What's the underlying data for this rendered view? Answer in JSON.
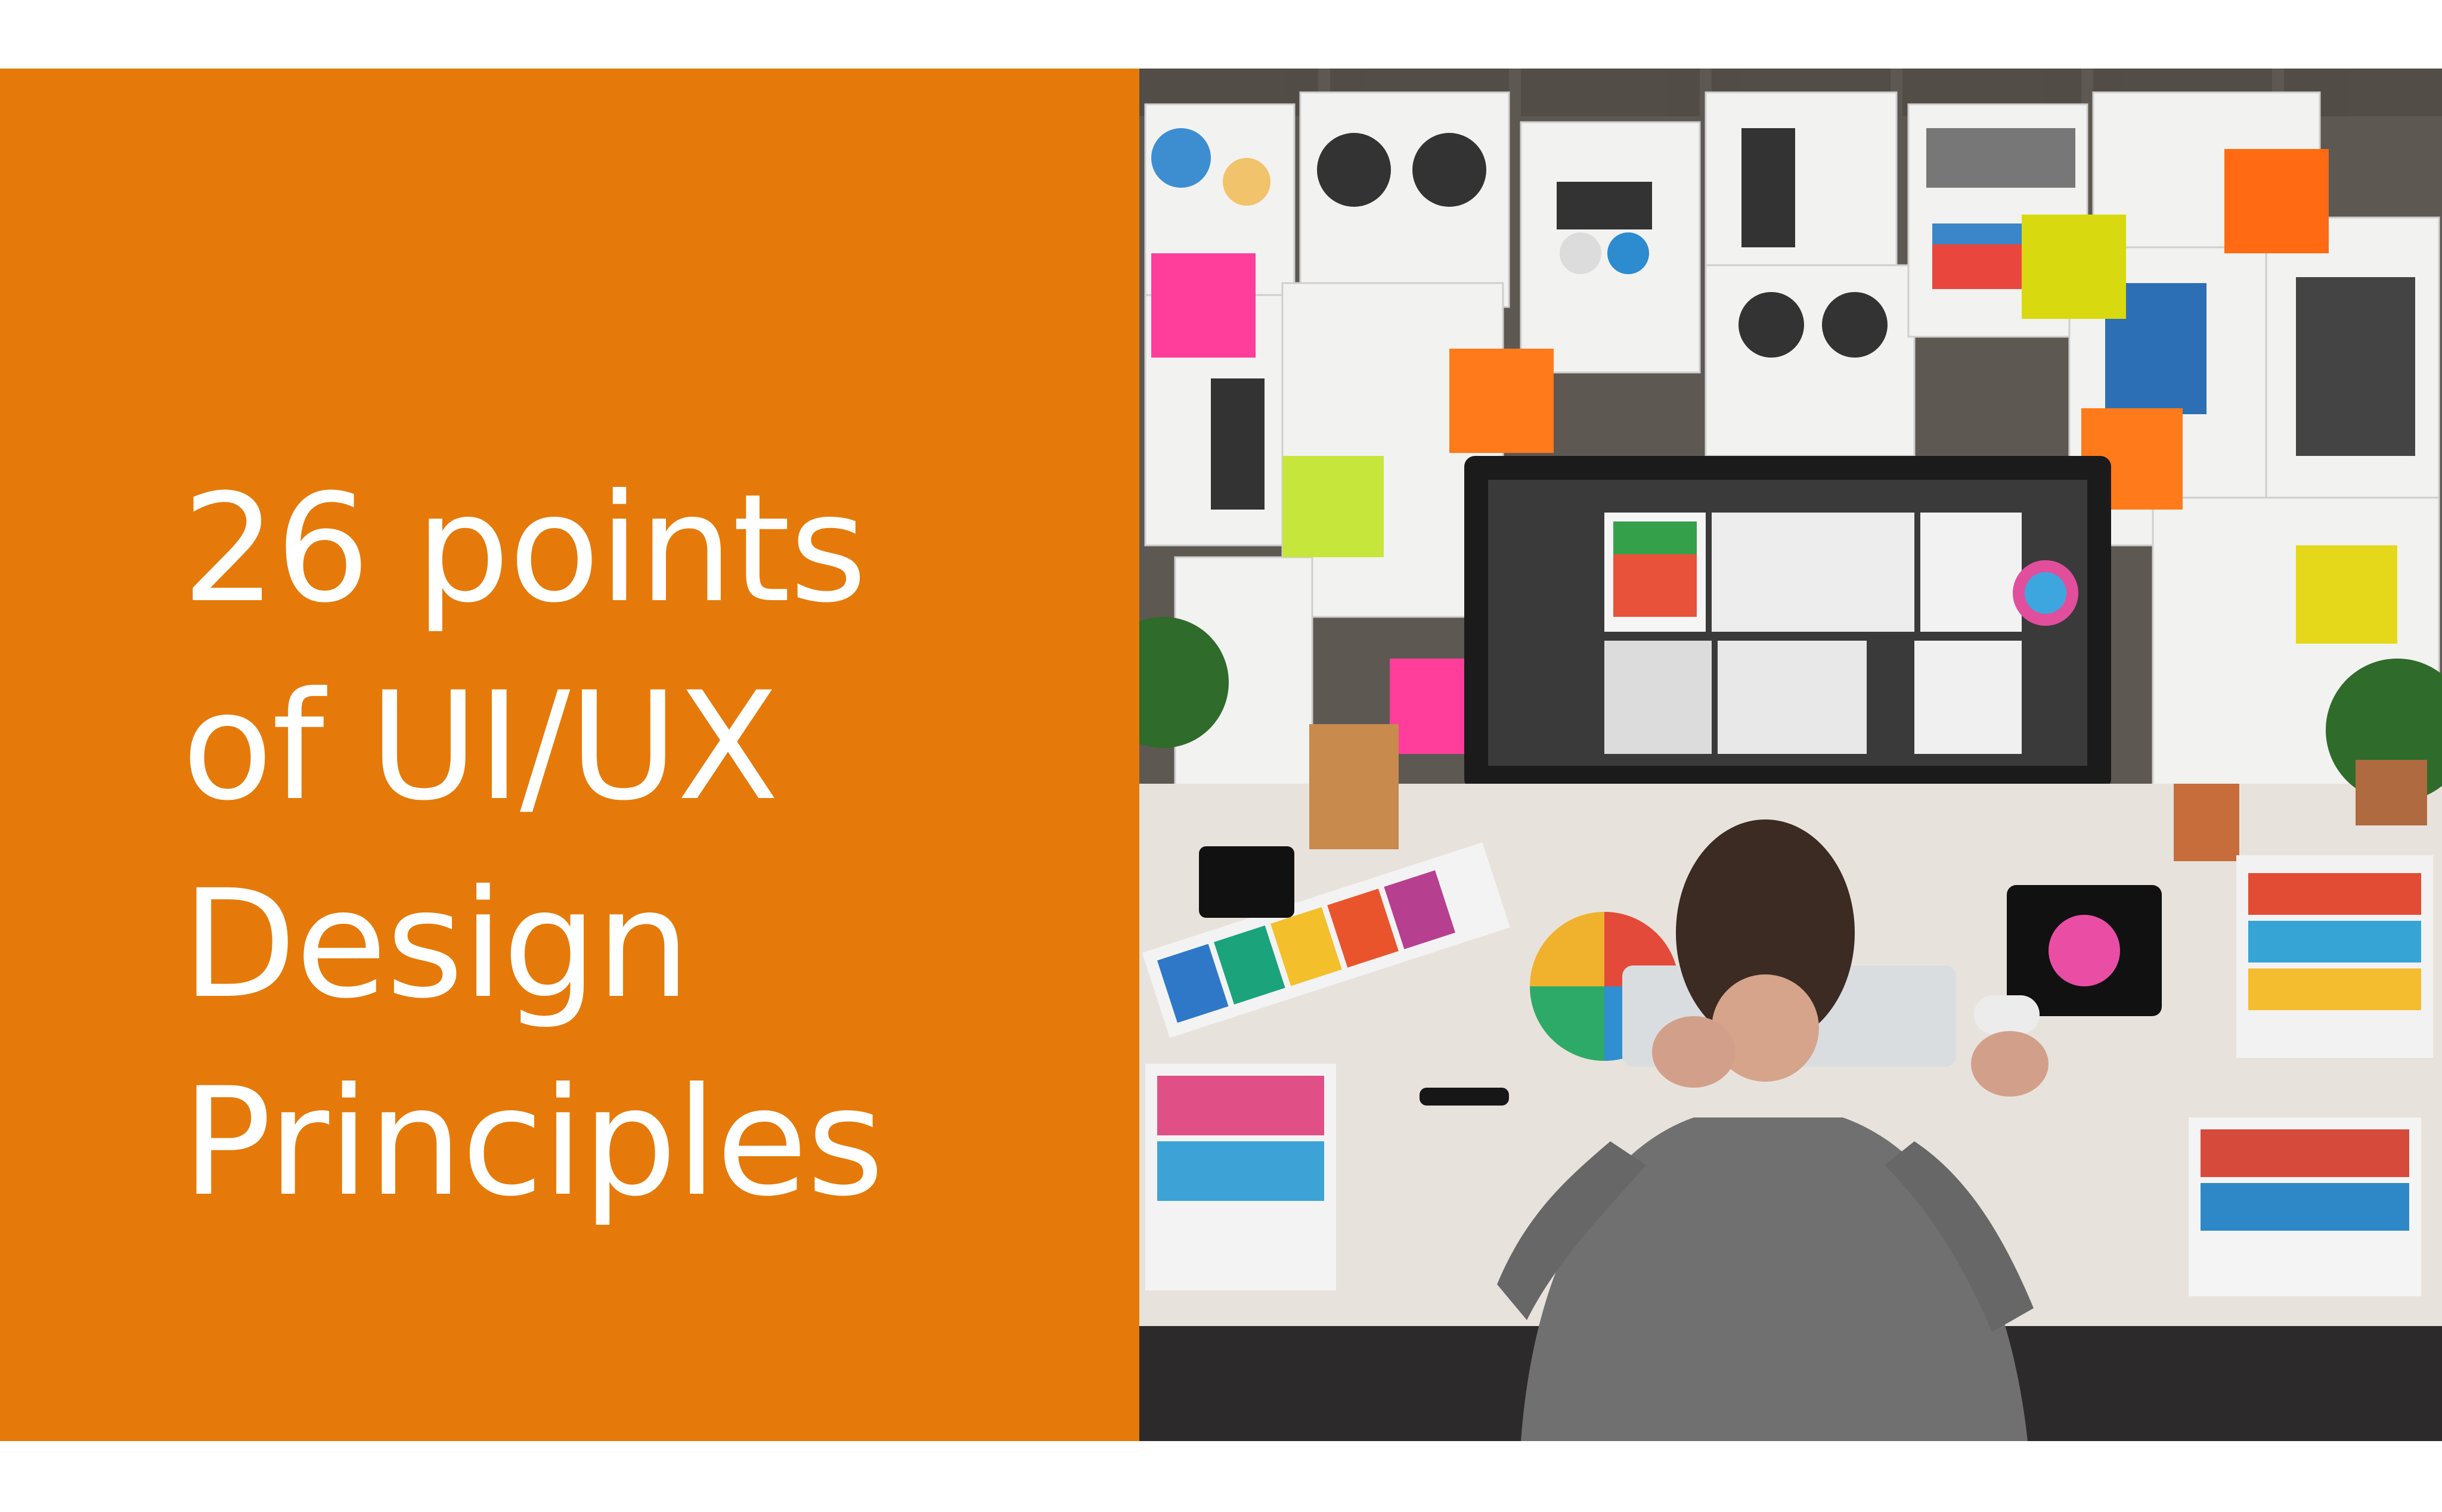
{
  "banner": {
    "title_lines": [
      "26 points",
      "of UI/UX",
      "Design",
      "Principles"
    ],
    "accent_color": "#e57a0a",
    "text_color": "#ffffff"
  },
  "photo": {
    "subject": "designer-workspace-illustration"
  }
}
